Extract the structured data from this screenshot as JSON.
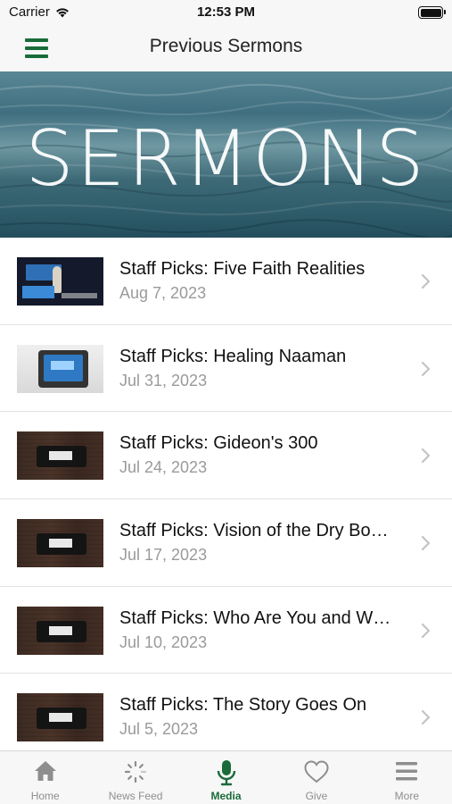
{
  "status_bar": {
    "carrier": "Carrier",
    "time": "12:53 PM",
    "battery_level": 1.0
  },
  "nav": {
    "title": "Previous Sermons",
    "menu_icon": "hamburger-menu-icon",
    "accent_color": "#1a6b3a"
  },
  "banner": {
    "text": "SERMONS"
  },
  "sermons": [
    {
      "title": "Staff Picks: Five Faith Realities",
      "date": "Aug 7, 2023"
    },
    {
      "title": "Staff Picks: Healing Naaman",
      "date": "Jul 31, 2023"
    },
    {
      "title": "Staff Picks: Gideon's 300",
      "date": "Jul 24, 2023"
    },
    {
      "title": "Staff Picks: Vision of the Dry Bo…",
      "date": "Jul 17, 2023"
    },
    {
      "title": "Staff Picks: Who Are You and W…",
      "date": "Jul 10, 2023"
    },
    {
      "title": "Staff Picks: The Story Goes On",
      "date": "Jul 5, 2023"
    }
  ],
  "tab_bar": {
    "tabs": [
      {
        "label": "Home",
        "icon": "home-icon",
        "active": false
      },
      {
        "label": "News Feed",
        "icon": "news-feed-icon",
        "active": false
      },
      {
        "label": "Media",
        "icon": "microphone-icon",
        "active": true
      },
      {
        "label": "Give",
        "icon": "heart-icon",
        "active": false
      },
      {
        "label": "More",
        "icon": "more-menu-icon",
        "active": false
      }
    ]
  }
}
